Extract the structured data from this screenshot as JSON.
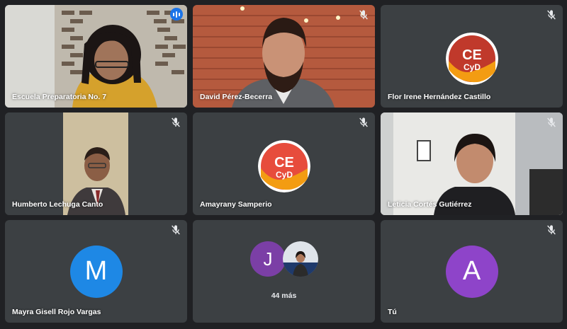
{
  "participants": [
    {
      "name": "Escuela Preparatoria No. 7",
      "speaking": true
    },
    {
      "name": "David Pérez-Becerra",
      "muted": true
    },
    {
      "name": "Flor Irene Hernández Castillo",
      "muted": true,
      "avatar": "CE CyD logo"
    },
    {
      "name": "Humberto Lechuga Canto",
      "muted": true
    },
    {
      "name": "Amayrany Samperio",
      "muted": true,
      "avatar": "CE CyD logo"
    },
    {
      "name": "Leticia Cortés Gutiérrez",
      "muted": true
    },
    {
      "name": "Mayra Gisell Rojo Vargas",
      "muted": true,
      "initial": "M",
      "color": "#1e88e5"
    },
    {
      "name": "",
      "others": {
        "initial": "J",
        "initial_color": "#7b3fa6",
        "text": "44 más"
      }
    },
    {
      "name": "Tú",
      "muted": true,
      "initial": "A",
      "color": "#8e44c9"
    }
  ],
  "logo": {
    "line1": "CE",
    "line2": "CyD"
  },
  "colors": {
    "speaking_ring": "#8ab4f8",
    "speaking_dot": "#1a73e8",
    "tile_bg": "#3c4043"
  }
}
